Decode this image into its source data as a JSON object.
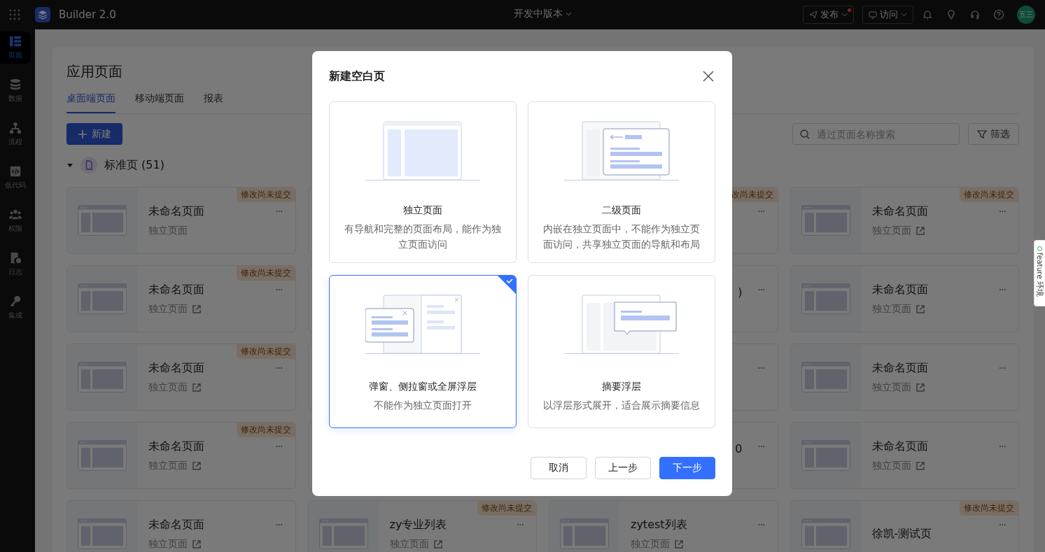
{
  "top_bar": {
    "app_name": "Builder 2.0",
    "version": "开发中版本",
    "actions": [
      {
        "kind": "publish",
        "label": "发布",
        "badge_dot": true
      },
      {
        "kind": "visit",
        "label": "访问",
        "badge_dot": false
      }
    ],
    "avatar": "五三"
  },
  "sidebar": {
    "items": [
      {
        "kind": "pages",
        "label": "页面",
        "selected": true
      },
      {
        "kind": "data",
        "label": "数据",
        "selected": false
      },
      {
        "kind": "flow",
        "label": "流程",
        "selected": false
      },
      {
        "kind": "lowcode",
        "label": "低代码",
        "selected": false
      },
      {
        "kind": "permission",
        "label": "权限",
        "selected": false
      },
      {
        "kind": "log",
        "label": "日志",
        "selected": false
      },
      {
        "kind": "integration",
        "label": "集成",
        "selected": false
      }
    ]
  },
  "page": {
    "title": "应用页面",
    "tabs": [
      {
        "label": "桌面端页面",
        "selected": true
      },
      {
        "label": "移动端页面",
        "selected": false
      },
      {
        "label": "报表",
        "selected": false
      }
    ],
    "new_button": "新建",
    "search": {
      "placeholder": "通过页面名称搜索"
    },
    "filter_button": "筛选",
    "group": {
      "label": "标准页 (51)",
      "expanded": true
    },
    "cards": [
      {
        "kind": "page",
        "title": "未命名页面",
        "subtitle": "独立页面",
        "link": false,
        "badge": "修改尚未提交",
        "more": "···"
      },
      {
        "kind": "covered"
      },
      {
        "kind": "covered",
        "badge": "改尚未提交",
        "more": "···"
      },
      {
        "kind": "page",
        "title": "未命名页面",
        "subtitle": "独立页面",
        "link": true,
        "badge": "修改尚未提交",
        "more": "···"
      },
      {
        "kind": "page",
        "title": "未命名页面",
        "subtitle": "独立页面",
        "link": true,
        "badge": "修改尚未提交",
        "more": "···"
      },
      {
        "kind": "covered"
      },
      {
        "kind": "covered",
        "title": ")",
        "more": "···"
      },
      {
        "kind": "page",
        "title": "未命名页面",
        "subtitle": "独立页面",
        "link": true,
        "more": "···"
      },
      {
        "kind": "page",
        "title": "未命名页面",
        "subtitle": "独立页面",
        "link": true,
        "badge": "修改尚未提交",
        "more": "···"
      },
      {
        "kind": "covered"
      },
      {
        "kind": "covered",
        "more": "···"
      },
      {
        "kind": "page",
        "title": "未命名页面",
        "subtitle": "独立页面",
        "link": true,
        "more": "···"
      },
      {
        "kind": "page",
        "title": "未命名页面",
        "subtitle": "独立页面",
        "link": true,
        "badge": "修改尚未提交",
        "more": "···"
      },
      {
        "kind": "covered"
      },
      {
        "kind": "covered",
        "title": "0",
        "more": "···"
      },
      {
        "kind": "page",
        "title": "未命名页面",
        "subtitle": "独立页面",
        "link": true,
        "more": "···"
      },
      {
        "kind": "page",
        "title": "未命名页面",
        "subtitle": "独立页面",
        "link": true,
        "more": "···"
      },
      {
        "kind": "page",
        "title": "zy专业列表",
        "subtitle": "独立页面",
        "link": true,
        "badge": "修改尚未提交",
        "more": "···"
      },
      {
        "kind": "page",
        "title": "zytest列表",
        "subtitle": "独立页面",
        "link": true,
        "more": "···"
      },
      {
        "kind": "page",
        "title": "徐凯-测试页",
        "badge": "修改尚未提交",
        "more": "···"
      }
    ]
  },
  "dialog": {
    "title": "新建空白页",
    "options": [
      {
        "kind": "standalone",
        "title": "独立页面",
        "description": "有导航和完整的页面布局，能作为独立页面访问",
        "selected": false
      },
      {
        "kind": "secondary",
        "title": "二级页面",
        "description": "内嵌在独立页面中，不能作为独立页面访问，共享独立页面的导航和布局",
        "selected": false
      },
      {
        "kind": "popup",
        "title": "弹窗、侧拉窗或全屏浮层",
        "description": "不能作为独立页面打开",
        "selected": true
      },
      {
        "kind": "summary",
        "title": "摘要浮层",
        "description": "以浮层形式展开，适合展示摘要信息",
        "selected": false
      }
    ],
    "buttons": [
      {
        "kind": "secondary",
        "label": "取消"
      },
      {
        "kind": "secondary",
        "label": "上一步"
      },
      {
        "kind": "primary",
        "label": "下一步"
      }
    ]
  },
  "env_tab": {
    "label": "feature 环境",
    "status_on": true
  }
}
